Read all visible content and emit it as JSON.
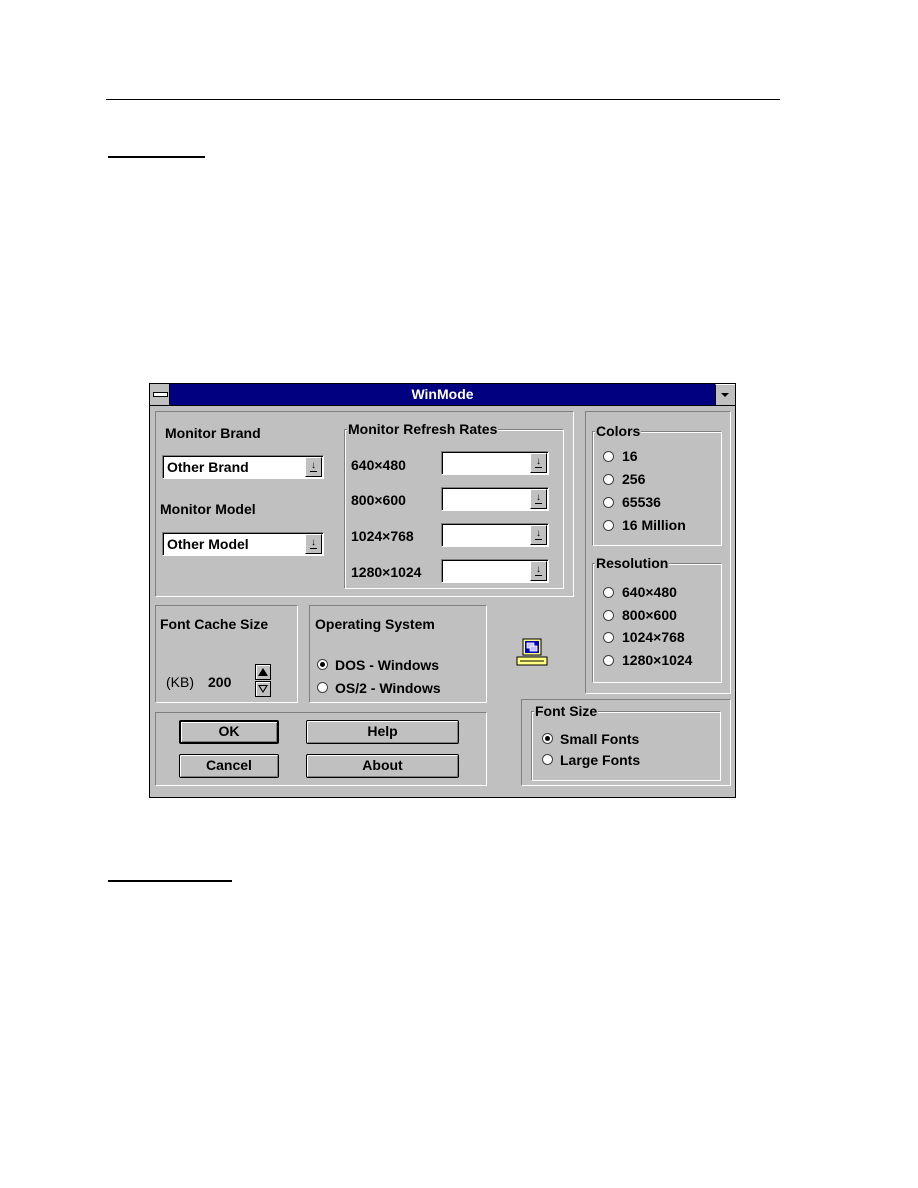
{
  "document": {
    "section_heading_1": "",
    "section_heading_2": ""
  },
  "window": {
    "title": "WinMode",
    "system_menu_icon": "system-menu-icon",
    "minimize_icon": "down-arrow-icon"
  },
  "monitor": {
    "brand_label": "Monitor Brand",
    "brand_value": "Other Brand",
    "model_label": "Monitor Model",
    "model_value": "Other Model"
  },
  "refresh_rates": {
    "label": "Monitor Refresh Rates",
    "rows": [
      {
        "resolution": "640x480",
        "display": "640×480",
        "value": ""
      },
      {
        "resolution": "800x600",
        "display": "800×600",
        "value": ""
      },
      {
        "resolution": "1024x768",
        "display": "1024×768",
        "value": ""
      },
      {
        "resolution": "1280x1024",
        "display": "1280×1024",
        "value": ""
      }
    ]
  },
  "colors": {
    "label": "Colors",
    "options": [
      "16",
      "256",
      "65536",
      "16 Million"
    ],
    "selected": null
  },
  "resolution": {
    "label": "Resolution",
    "options": [
      "640×480",
      "800×600",
      "1024×768",
      "1280×1024"
    ],
    "selected": null
  },
  "font_cache": {
    "label": "Font Cache Size",
    "unit": "(KB)",
    "value": "200"
  },
  "operating_system": {
    "label": "Operating System",
    "options": [
      "DOS -  Windows",
      "OS/2 - Windows"
    ],
    "selected": "DOS -  Windows"
  },
  "font_size": {
    "label": "Font Size",
    "options": [
      "Small Fonts",
      "Large Fonts"
    ],
    "selected": "Small Fonts"
  },
  "buttons": {
    "ok": "OK",
    "cancel": "Cancel",
    "help": "Help",
    "about": "About"
  },
  "icons": {
    "dropdown_arrow": "↓",
    "monitor": "monitor-icon"
  },
  "colors_theme": {
    "titlebar": "#000080",
    "face": "#c0c0c0"
  }
}
